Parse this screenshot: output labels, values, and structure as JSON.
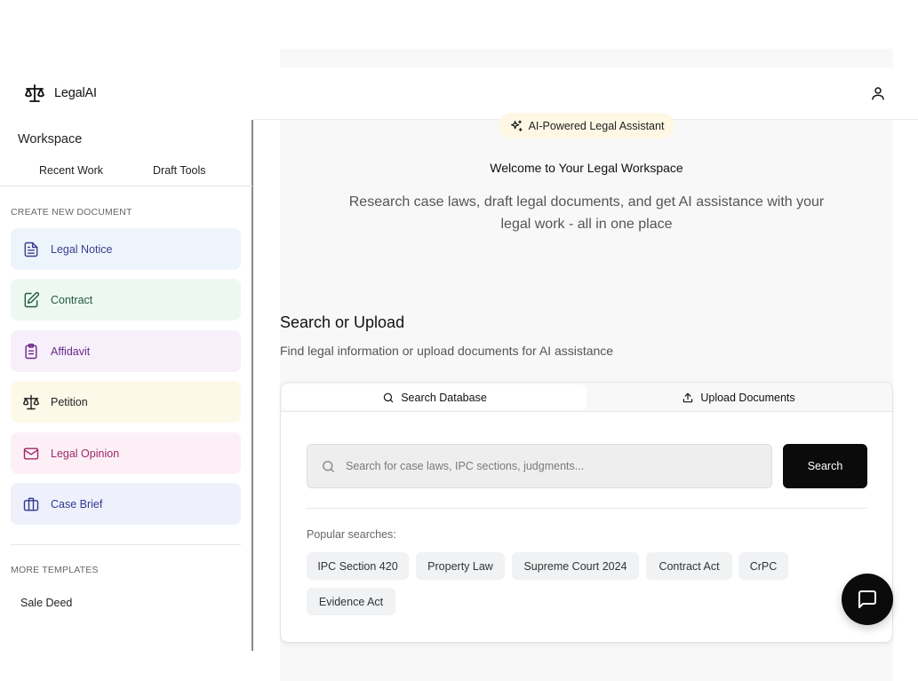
{
  "app": {
    "name": "LegalAI"
  },
  "sidebar": {
    "title": "Workspace",
    "tabs": [
      "Recent Work",
      "Draft Tools"
    ],
    "create_label": "CREATE NEW DOCUMENT",
    "documents": [
      {
        "label": "Legal Notice",
        "icon": "file-text-icon",
        "color": "#3b3f8f",
        "bg": "#eef4fc"
      },
      {
        "label": "Contract",
        "icon": "file-edit-icon",
        "color": "#1f5a44",
        "bg": "#eef8f3"
      },
      {
        "label": "Affidavit",
        "icon": "clipboard-icon",
        "color": "#6a2a8a",
        "bg": "#f7f0fb"
      },
      {
        "label": "Petition",
        "icon": "scales-icon",
        "color": "#222222",
        "bg": "#fdf9e8"
      },
      {
        "label": "Legal Opinion",
        "icon": "mail-icon",
        "color": "#a0266a",
        "bg": "#fcf0f6"
      },
      {
        "label": "Case Brief",
        "icon": "briefcase-icon",
        "color": "#2f3a8f",
        "bg": "#eef0fc"
      }
    ],
    "more_label": "MORE TEMPLATES",
    "templates": [
      "Sale Deed"
    ]
  },
  "hero": {
    "badge": "AI-Powered Legal Assistant",
    "welcome": "Welcome to Your Legal Workspace",
    "subtitle": "Research case laws, draft legal documents, and get AI assistance with your legal work - all in one place"
  },
  "search_section": {
    "title": "Search or Upload",
    "description": "Find legal information or upload documents for AI assistance",
    "tabs": {
      "search": "Search Database",
      "upload": "Upload Documents"
    },
    "placeholder": "Search for case laws, IPC sections, judgments...",
    "button": "Search",
    "popular_label": "Popular searches:",
    "popular": [
      "IPC Section 420",
      "Property Law",
      "Supreme Court 2024",
      "Contract Act",
      "CrPC",
      "Evidence Act"
    ]
  }
}
